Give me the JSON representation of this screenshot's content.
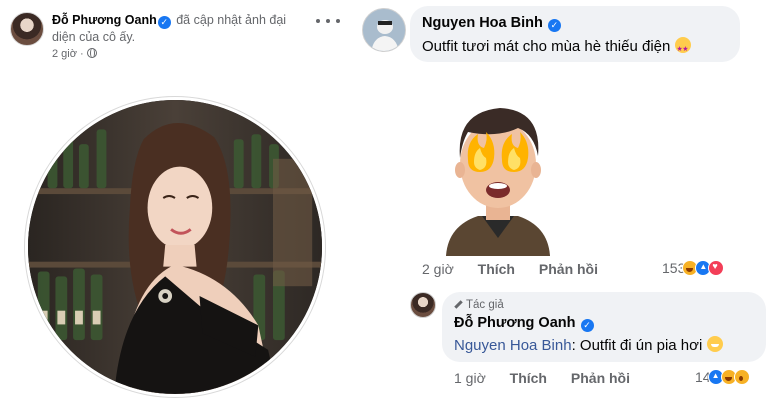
{
  "post": {
    "author": "Đỗ Phương Oanh",
    "action_text": "đã cập nhật ảnh đại diện của cô ấy.",
    "time": "2 giờ",
    "privacy_icon": "globe-icon",
    "more_icon": "more-options-icon"
  },
  "comments": [
    {
      "author": "Nguyen Hoa Binh",
      "text": "Outfit tươi mát cho mùa hè thiếu điện",
      "emoji": "star-struck-emoji",
      "sticker": "fire-eyes-avatar-sticker",
      "time": "2 giờ",
      "like_label": "Thích",
      "reply_label": "Phản hồi",
      "reaction_count": "153",
      "reactions": [
        "haha",
        "like",
        "love"
      ]
    },
    {
      "author_tag": "Tác giả",
      "author": "Đỗ Phương Oanh",
      "mention": "Nguyen Hoa Binh",
      "text": ": Outfit đi ún pia hơi",
      "emoji": "blush-emoji",
      "time": "1 giờ",
      "like_label": "Thích",
      "reply_label": "Phản hồi",
      "reaction_count": "14",
      "reactions": [
        "like",
        "haha",
        "wow"
      ]
    }
  ],
  "colors": {
    "bubble_bg": "#f0f2f5",
    "verified_blue": "#1877f2",
    "mention_blue": "#385898",
    "secondary_text": "#65676b"
  }
}
